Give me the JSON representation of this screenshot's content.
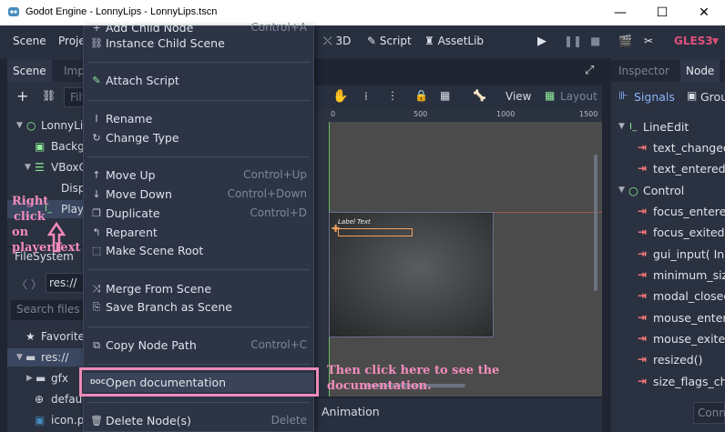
{
  "window": {
    "title": "Godot Engine - LonnyLips - LonnyLips.tscn",
    "minimize": "—",
    "maximize": "☐",
    "close": "✕"
  },
  "menubar": {
    "scene": "Scene",
    "project_partial": "Proje",
    "tool_3d": "3D",
    "tool_script": "Script",
    "tool_assetlib": "AssetLib",
    "renderer": "GLES3"
  },
  "scene_dock": {
    "tab_scene": "Scene",
    "tab_import_partial": "Imp",
    "filter_partial": "Filt",
    "tree": [
      {
        "label": "LonnyLi"
      },
      {
        "label": "Backg"
      },
      {
        "label": "VBoxC"
      },
      {
        "label": "Disp"
      },
      {
        "label": "Play"
      }
    ]
  },
  "filesystem_dock": {
    "title": "FileSystem",
    "path": "res://",
    "search_placeholder": "Search files",
    "favorites": "Favorite",
    "res": "res://",
    "gfx": "gfx",
    "default_partial": "defau",
    "icon_partial": "icon.p"
  },
  "context_menu": {
    "top_partial": "Add Child Node",
    "top_partial_shortcut": "Control+A",
    "items": [
      {
        "icon": "link-icon",
        "label": "Instance Child Scene",
        "shortcut": ""
      },
      {
        "icon": "script-add-icon",
        "label": "Attach Script",
        "shortcut": ""
      },
      {
        "icon": "rename-icon",
        "label": "Rename",
        "shortcut": ""
      },
      {
        "icon": "change-type-icon",
        "label": "Change Type",
        "shortcut": ""
      },
      {
        "icon": "move-up-icon",
        "label": "Move Up",
        "shortcut": "Control+Up"
      },
      {
        "icon": "move-down-icon",
        "label": "Move Down",
        "shortcut": "Control+Down"
      },
      {
        "icon": "duplicate-icon",
        "label": "Duplicate",
        "shortcut": "Control+D"
      },
      {
        "icon": "reparent-icon",
        "label": "Reparent",
        "shortcut": ""
      },
      {
        "icon": "make-root-icon",
        "label": "Make Scene Root",
        "shortcut": ""
      },
      {
        "icon": "merge-icon",
        "label": "Merge From Scene",
        "shortcut": ""
      },
      {
        "icon": "save-branch-icon",
        "label": "Save Branch as Scene",
        "shortcut": ""
      },
      {
        "icon": "copy-path-icon",
        "label": "Copy Node Path",
        "shortcut": "Control+C"
      },
      {
        "icon": "doc-icon",
        "label": "Open documentation",
        "shortcut": ""
      },
      {
        "icon": "delete-icon",
        "label": "Delete Node(s)",
        "shortcut": "Delete"
      }
    ]
  },
  "viewport": {
    "view": "View",
    "layout": "Layout",
    "ruler_ticks": [
      "0",
      "500",
      "1000",
      "1500"
    ],
    "label_text": "Label Text",
    "bottom_tab": "Animation"
  },
  "inspector": {
    "tab_inspector": "Inspector",
    "tab_node": "Node",
    "signals": "Signals",
    "groups_partial": "Grou",
    "sections": [
      {
        "name": "LineEdit",
        "signals": [
          "text_changed(",
          "text_entered("
        ]
      },
      {
        "name": "Control",
        "signals": [
          "focus_entered",
          "focus_exited()",
          "gui_input( Inpu",
          "minimum_size",
          "modal_closed",
          "mouse_entere",
          "mouse_exited",
          "resized()",
          "size_flags_cha"
        ]
      }
    ],
    "connect_partial": "Conn"
  },
  "annotations": {
    "left": "Right click on playerText",
    "left_lines": [
      "Right",
      "click",
      "on",
      "playerText"
    ],
    "right_lines": [
      "Then click here to see the",
      "documentation."
    ]
  },
  "colors": {
    "accent": "#8ab4f8",
    "annotation": "#f08ab8",
    "signal_arrow": "#ff7a7a",
    "renderer": "#e0507a"
  }
}
